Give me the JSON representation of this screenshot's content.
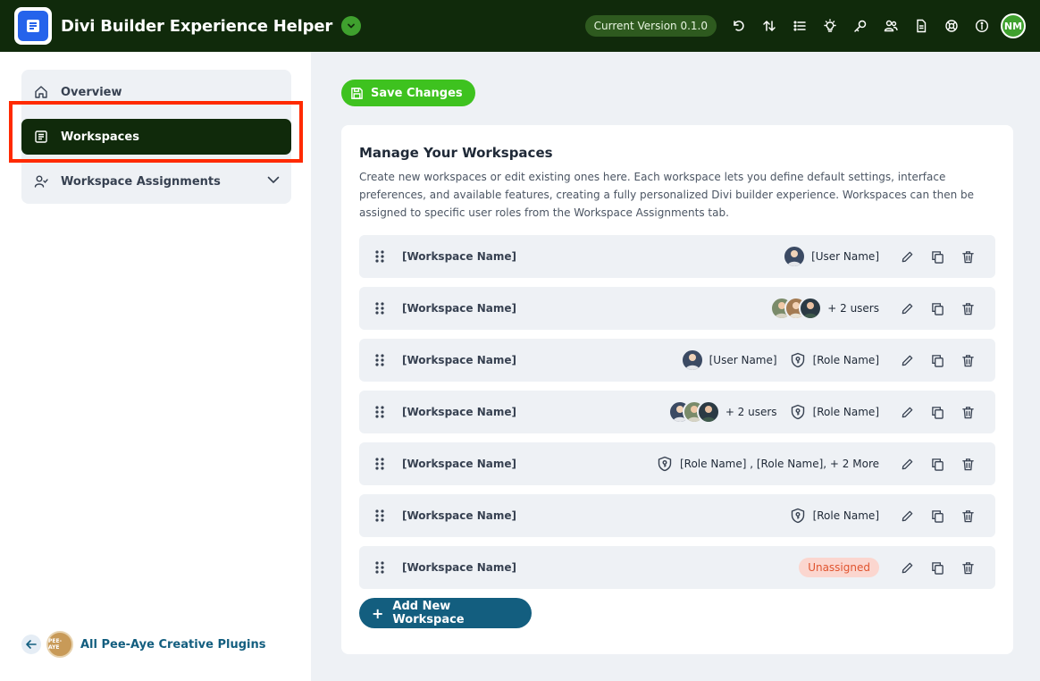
{
  "app": {
    "title": "Divi Builder Experience Helper",
    "version": "Current Version 0.1.0",
    "user_initials": "NM"
  },
  "header_icons": [
    "undo-icon",
    "sort-icon",
    "list-icon",
    "lightbulb-icon",
    "key-icon",
    "users-icon",
    "document-icon",
    "lifebuoy-icon",
    "info-icon"
  ],
  "sidebar": {
    "items": [
      {
        "label": "Overview",
        "icon": "home-icon"
      },
      {
        "label": "Workspaces",
        "icon": "document-icon"
      },
      {
        "label": "Workspace Assignments",
        "icon": "user-check-icon"
      }
    ],
    "footer_link": "All Pee-Aye Creative Plugins",
    "brand_badge": "PEE-AYE"
  },
  "main": {
    "save_label": "Save Changes",
    "card_title": "Manage Your Workspaces",
    "card_desc": "Create new workspaces or edit existing ones here. Each workspace lets you define default settings, interface preferences, and available features, creating a fully personalized Divi builder experience. Workspaces can then be assigned to specific user roles from the Workspace Assignments tab.",
    "workspaces": [
      {
        "name": "[Workspace Name]",
        "users": "[User Name]",
        "roles": "",
        "status": ""
      },
      {
        "name": "[Workspace Name]",
        "users": "+ 2 users",
        "roles": "",
        "status": ""
      },
      {
        "name": "[Workspace Name]",
        "users": "[User Name]",
        "roles": "[Role Name]",
        "status": ""
      },
      {
        "name": "[Workspace Name]",
        "users": "+ 2 users",
        "roles": "[Role Name]",
        "status": ""
      },
      {
        "name": "[Workspace Name]",
        "users": "",
        "roles": "[Role Name] , [Role Name], + 2 More",
        "status": ""
      },
      {
        "name": "[Workspace Name]",
        "users": "",
        "roles": "[Role Name]",
        "status": ""
      },
      {
        "name": "[Workspace Name]",
        "users": "",
        "roles": "",
        "status": "Unassigned"
      }
    ],
    "add_label": "Add New Workspace"
  },
  "colors": {
    "header_bg": "#102a0b",
    "accent_green": "#3ec21f",
    "primary_blue": "#135e7f",
    "highlight": "#ff2a00"
  }
}
